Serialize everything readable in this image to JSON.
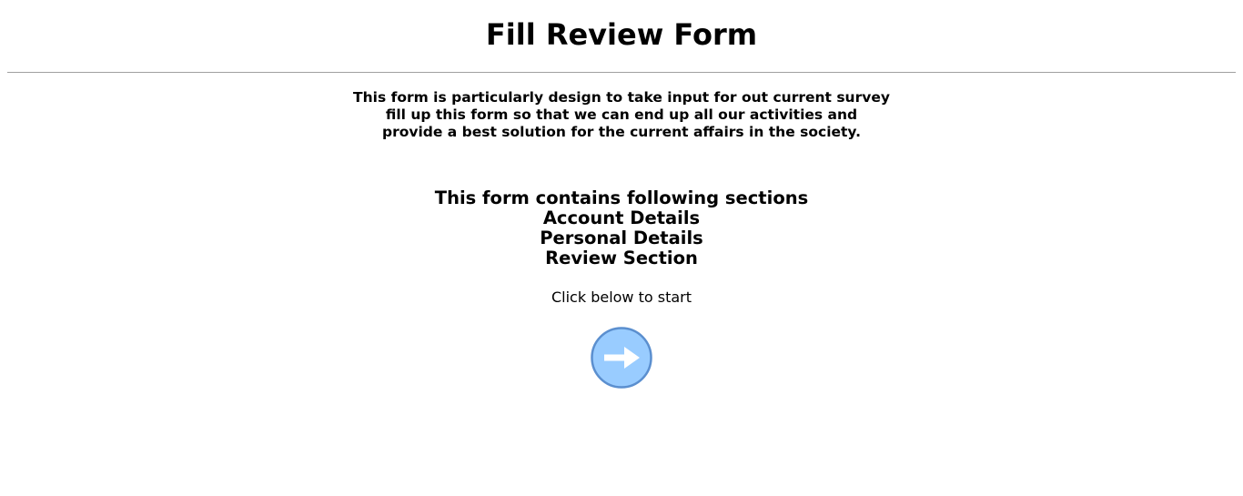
{
  "header": {
    "title": "Fill Review Form"
  },
  "intro": {
    "lines": [
      "This form is particularly design to take input for out current survey",
      "fill up this form so that we can end up all our activities and",
      "provide a best solution for the current affairs in the society."
    ]
  },
  "sections": {
    "heading": "This form contains following sections",
    "items": [
      "Account Details",
      "Personal Details",
      "Review Section"
    ]
  },
  "start": {
    "prompt": "Click below to start",
    "button_icon": "arrow-right-icon"
  },
  "colors": {
    "button_fill": "#99ccff",
    "button_border": "#5b8fcf",
    "arrow": "#ffffff",
    "divider": "#a0a0a0"
  }
}
